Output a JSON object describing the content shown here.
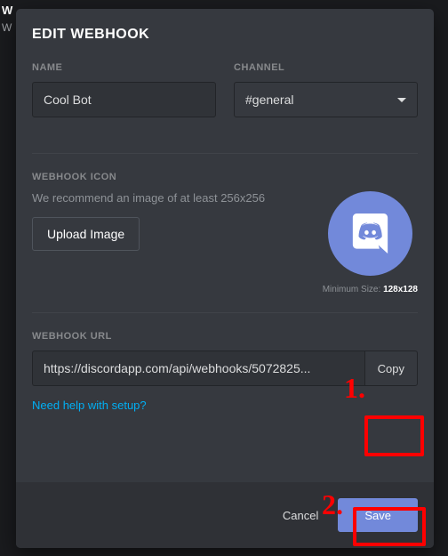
{
  "background": {
    "heading_fragment": "W",
    "desc_fragment": "W"
  },
  "modal": {
    "title": "EDIT WEBHOOK",
    "name": {
      "label": "NAME",
      "value": "Cool Bot"
    },
    "channel": {
      "label": "CHANNEL",
      "value": "#general"
    },
    "icon": {
      "label": "WEBHOOK ICON",
      "hint": "We recommend an image of at least 256x256",
      "upload_label": "Upload Image",
      "min_size_prefix": "Minimum Size: ",
      "min_size_value": "128x128"
    },
    "url": {
      "label": "WEBHOOK URL",
      "value": "https://discordapp.com/api/webhooks/5072825...",
      "copy_label": "Copy"
    },
    "help_link": "Need help with setup?",
    "footer": {
      "cancel": "Cancel",
      "save": "Save"
    }
  },
  "annotations": {
    "one": "1.",
    "two": "2."
  }
}
